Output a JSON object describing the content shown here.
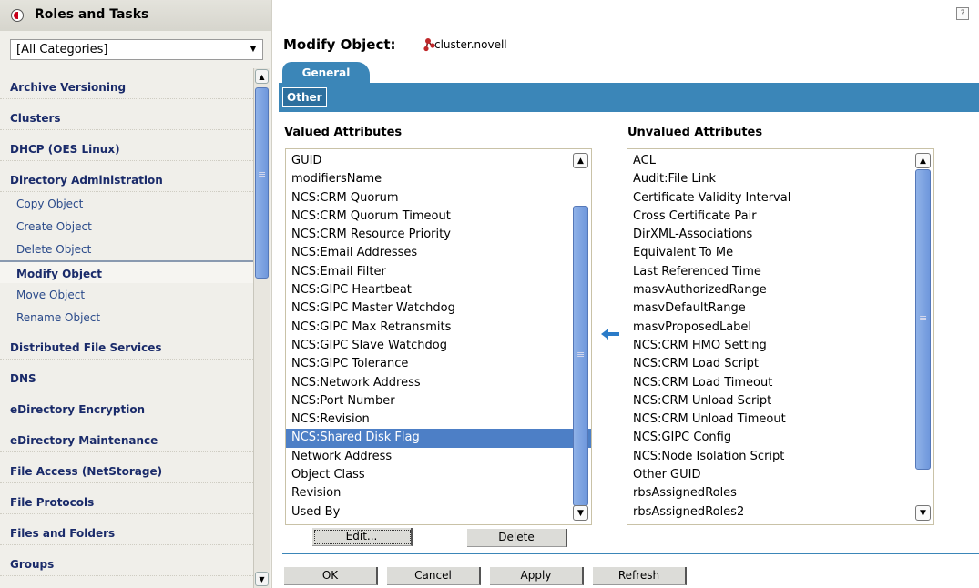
{
  "nav": {
    "title": "Roles and Tasks",
    "category_select": {
      "value": "[All Categories]"
    },
    "items": [
      {
        "label": "Archive Versioning",
        "type": "category"
      },
      {
        "label": "Clusters",
        "type": "category"
      },
      {
        "label": "DHCP (OES Linux)",
        "type": "category"
      },
      {
        "label": "Directory Administration",
        "type": "category"
      },
      {
        "label": "Copy Object",
        "type": "task"
      },
      {
        "label": "Create Object",
        "type": "task"
      },
      {
        "label": "Delete Object",
        "type": "task"
      },
      {
        "label": "Modify Object",
        "type": "task",
        "selected": true
      },
      {
        "label": "Move Object",
        "type": "task"
      },
      {
        "label": "Rename Object",
        "type": "task"
      },
      {
        "label": "Distributed File Services",
        "type": "category"
      },
      {
        "label": "DNS",
        "type": "category"
      },
      {
        "label": "eDirectory Encryption",
        "type": "category"
      },
      {
        "label": "eDirectory Maintenance",
        "type": "category"
      },
      {
        "label": "File Access (NetStorage)",
        "type": "category"
      },
      {
        "label": "File Protocols",
        "type": "category"
      },
      {
        "label": "Files and Folders",
        "type": "category"
      },
      {
        "label": "Groups",
        "type": "category"
      }
    ]
  },
  "main": {
    "title": "Modify Object:",
    "object_name": "cluster.novell",
    "tabs": [
      {
        "label": "General",
        "active": true
      }
    ],
    "subtabs": [
      {
        "label": "Other",
        "active": true
      }
    ],
    "valued": {
      "title": "Valued Attributes",
      "items": [
        "GUID",
        "modifiersName",
        "NCS:CRM Quorum",
        "NCS:CRM Quorum Timeout",
        "NCS:CRM Resource Priority",
        "NCS:Email Addresses",
        "NCS:Email Filter",
        "NCS:GIPC Heartbeat",
        "NCS:GIPC Master Watchdog",
        "NCS:GIPC Max Retransmits",
        "NCS:GIPC Slave Watchdog",
        "NCS:GIPC Tolerance",
        "NCS:Network Address",
        "NCS:Port Number",
        "NCS:Revision",
        "NCS:Shared Disk Flag",
        "Network Address",
        "Object Class",
        "Revision",
        "Used By"
      ],
      "selected_index": 15
    },
    "unvalued": {
      "title": "Unvalued Attributes",
      "items": [
        "ACL",
        "Audit:File Link",
        "Certificate Validity Interval",
        "Cross Certificate Pair",
        "DirXML-Associations",
        "Equivalent To Me",
        "Last Referenced Time",
        "masvAuthorizedRange",
        "masvDefaultRange",
        "masvProposedLabel",
        "NCS:CRM HMO Setting",
        "NCS:CRM Load Script",
        "NCS:CRM Load Timeout",
        "NCS:CRM Unload Script",
        "NCS:CRM Unload Timeout",
        "NCS:GIPC Config",
        "NCS:Node Isolation Script",
        "Other GUID",
        "rbsAssignedRoles",
        "rbsAssignedRoles2"
      ]
    },
    "list_buttons": {
      "edit": "Edit...",
      "delete": "Delete"
    },
    "footer_buttons": {
      "ok": "OK",
      "cancel": "Cancel",
      "apply": "Apply",
      "refresh": "Refresh"
    }
  },
  "colors": {
    "accent": "#3b86b8",
    "selection": "#4d7fc6",
    "nav_link": "#1a2b6a",
    "brand_red": "#c8001a"
  }
}
